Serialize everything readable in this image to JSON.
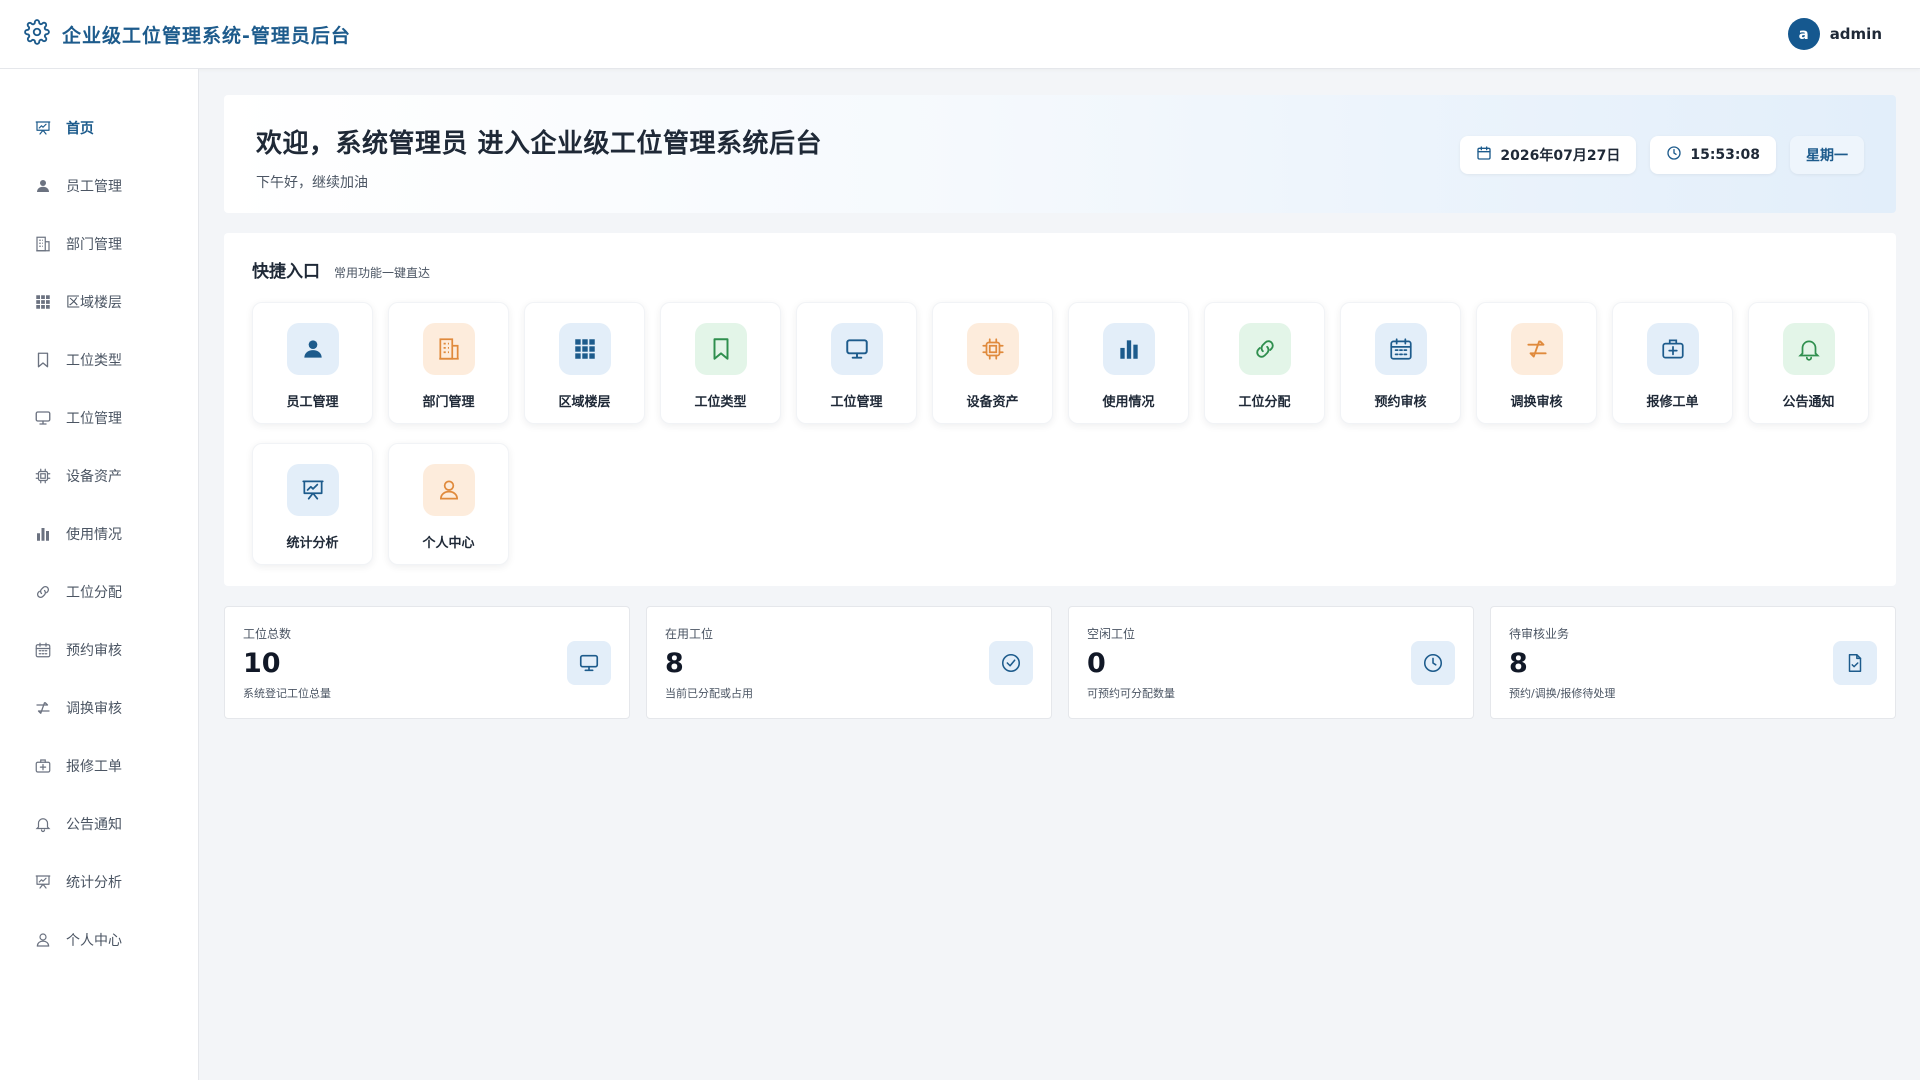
{
  "header": {
    "title": "企业级工位管理系统-管理员后台",
    "avatar_letter": "a",
    "username": "admin"
  },
  "sidebar": {
    "items": [
      {
        "label": "首页",
        "icon": "presentation-chart-icon",
        "active": true
      },
      {
        "label": "员工管理",
        "icon": "user-icon"
      },
      {
        "label": "部门管理",
        "icon": "building-icon"
      },
      {
        "label": "区域楼层",
        "icon": "grid-icon"
      },
      {
        "label": "工位类型",
        "icon": "bookmark-icon"
      },
      {
        "label": "工位管理",
        "icon": "monitor-icon"
      },
      {
        "label": "设备资产",
        "icon": "chip-icon"
      },
      {
        "label": "使用情况",
        "icon": "bar-chart-icon"
      },
      {
        "label": "工位分配",
        "icon": "link-icon"
      },
      {
        "label": "预约审核",
        "icon": "calendar-icon"
      },
      {
        "label": "调换审核",
        "icon": "swap-icon"
      },
      {
        "label": "报修工单",
        "icon": "medkit-icon"
      },
      {
        "label": "公告通知",
        "icon": "bell-icon"
      },
      {
        "label": "统计分析",
        "icon": "presentation-chart-icon"
      },
      {
        "label": "个人中心",
        "icon": "user-outline-icon"
      }
    ]
  },
  "welcome": {
    "title": "欢迎，系统管理员 进入企业级工位管理系统后台",
    "subtitle": "下午好，继续加油",
    "date": "2026年07月27日",
    "time": "15:53:08",
    "weekday": "星期一"
  },
  "quick": {
    "title": "快捷入口",
    "subtitle": "常用功能一键直达",
    "items": [
      {
        "label": "员工管理",
        "icon": "user-icon",
        "tone": "blue"
      },
      {
        "label": "部门管理",
        "icon": "building-icon",
        "tone": "orange"
      },
      {
        "label": "区域楼层",
        "icon": "grid-icon",
        "tone": "blue"
      },
      {
        "label": "工位类型",
        "icon": "bookmark-icon",
        "tone": "green"
      },
      {
        "label": "工位管理",
        "icon": "monitor-icon",
        "tone": "blue"
      },
      {
        "label": "设备资产",
        "icon": "chip-icon",
        "tone": "orange"
      },
      {
        "label": "使用情况",
        "icon": "bar-chart-icon",
        "tone": "blue"
      },
      {
        "label": "工位分配",
        "icon": "link-icon",
        "tone": "green"
      },
      {
        "label": "预约审核",
        "icon": "calendar-icon",
        "tone": "blue"
      },
      {
        "label": "调换审核",
        "icon": "swap-icon",
        "tone": "orange"
      },
      {
        "label": "报修工单",
        "icon": "medkit-icon",
        "tone": "blue"
      },
      {
        "label": "公告通知",
        "icon": "bell-icon",
        "tone": "green"
      },
      {
        "label": "统计分析",
        "icon": "presentation-chart-icon",
        "tone": "blue"
      },
      {
        "label": "个人中心",
        "icon": "user-outline-icon",
        "tone": "orange"
      }
    ]
  },
  "stats": [
    {
      "label": "工位总数",
      "value": "10",
      "desc": "系统登记工位总量",
      "icon": "monitor-icon"
    },
    {
      "label": "在用工位",
      "value": "8",
      "desc": "当前已分配或占用",
      "icon": "check-circle-icon"
    },
    {
      "label": "空闲工位",
      "value": "0",
      "desc": "可预约可分配数量",
      "icon": "clock-icon"
    },
    {
      "label": "待审核业务",
      "value": "8",
      "desc": "预约/调换/报修待处理",
      "icon": "document-check-icon"
    }
  ],
  "colors": {
    "brand": "#1d5b8c",
    "blue_icon": "#1d5b8c",
    "orange_icon": "#e08a3c",
    "green_icon": "#2f8f4e",
    "sidebar_icon": "#6b7280"
  }
}
